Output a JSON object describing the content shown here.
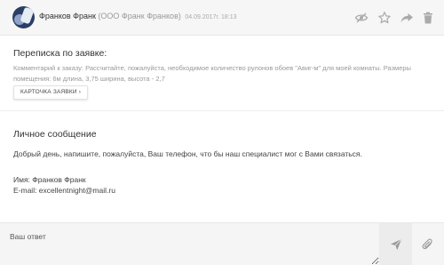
{
  "header": {
    "sender_name": "Франков Франк",
    "sender_org": "(ООО Франк Франков)",
    "date": "04.09.2017г. 18:13",
    "icons": [
      "eye-off-icon",
      "star-icon",
      "forward-icon",
      "trash-icon"
    ]
  },
  "request_section": {
    "title": "Переписка по заявке:",
    "comment": "Комментарий к заказу: Рассчитайте, пожалуйста, необходимое количество рулонов обоев \"Авиг-м\" для моей комнаты. Размеры помещения: 6м длина, 3,75 ширина, высота - 2,7",
    "card_button_label": "КАРТОЧКА ЗАЯВКИ ›"
  },
  "message_section": {
    "title": "Личное сообщение",
    "body": "Добрый день, напишите, пожалуйста, Ваш телефон, что бы наш специалист мог с Вами связаться.",
    "name_line": "Имя: Франков Франк",
    "email_line": "E-mail: excellentnight@mail.ru"
  },
  "reply": {
    "placeholder": "Ваш ответ",
    "icons": [
      "send-icon",
      "paperclip-icon"
    ]
  },
  "colors": {
    "header_bg": "#f6f6f6",
    "muted_text": "#999999",
    "icon_gray": "#aaaaaa"
  }
}
